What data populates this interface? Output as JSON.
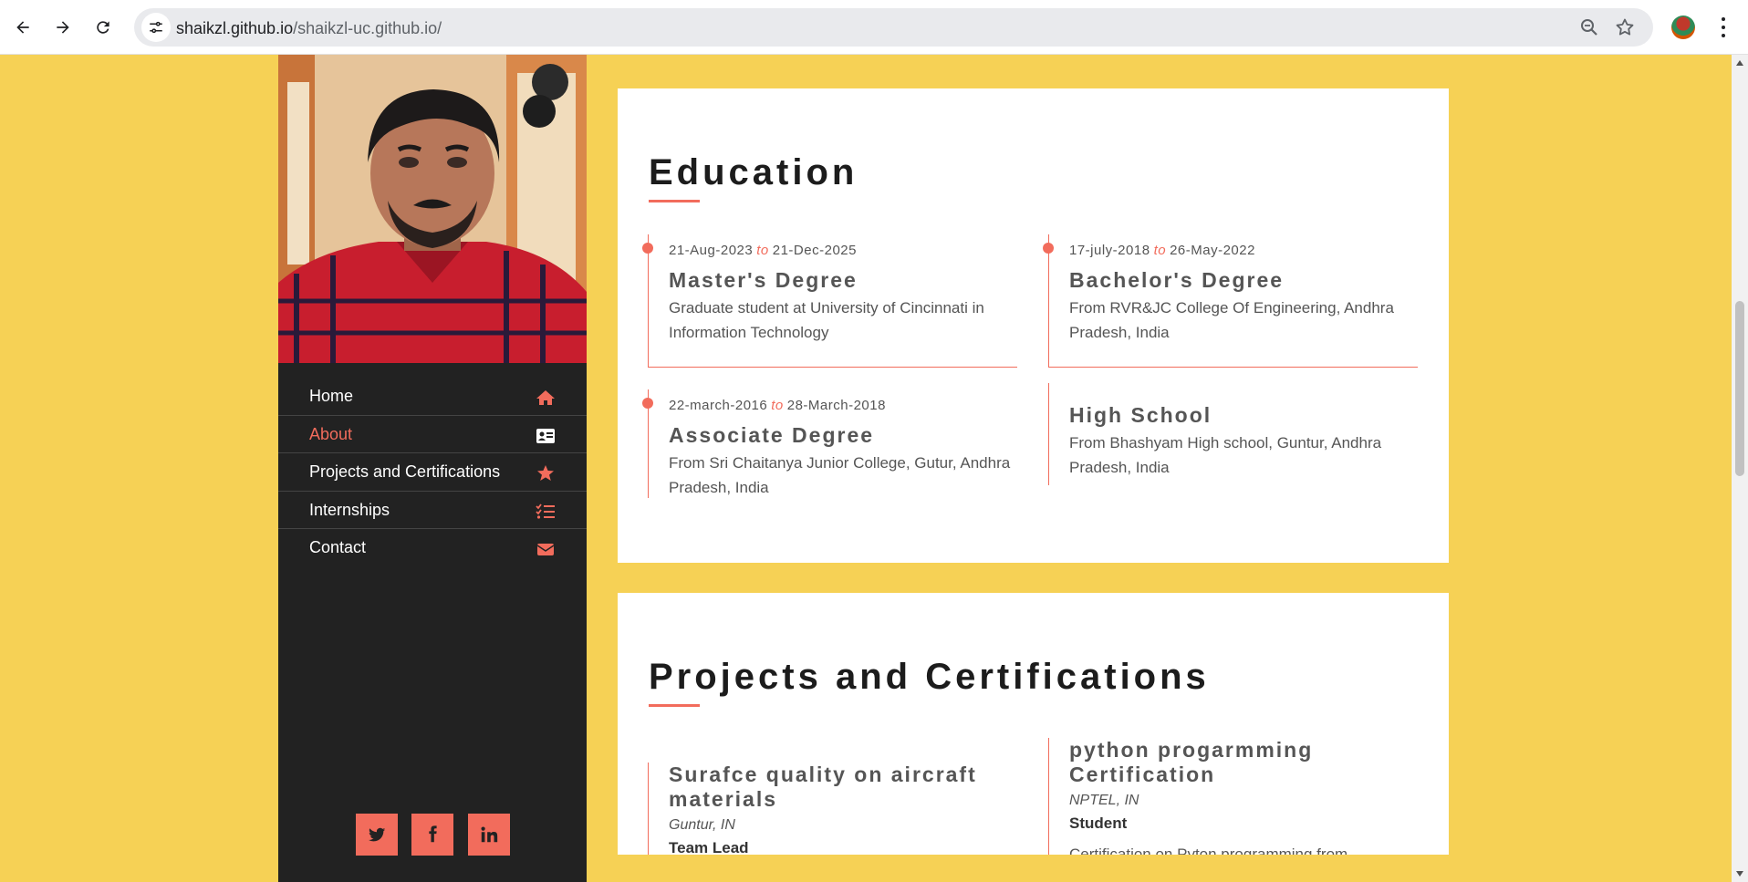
{
  "browser": {
    "url_host": "shaikzl.github.io",
    "url_path": "/shaikzl-uc.github.io/"
  },
  "colors": {
    "accent": "#f26c5c",
    "page_background": "#f6d155",
    "sidebar_background": "#222222"
  },
  "sidebar": {
    "photo_icon": "profile-photo",
    "nav": [
      {
        "label": "Home",
        "icon": "home-icon",
        "active": false
      },
      {
        "label": "About",
        "icon": "id-card-icon",
        "active": true
      },
      {
        "label": "Projects and Certifications",
        "icon": "star-icon",
        "active": false
      },
      {
        "label": "Internships",
        "icon": "list-check-icon",
        "active": false
      },
      {
        "label": "Contact",
        "icon": "envelope-icon",
        "active": false
      }
    ],
    "social": [
      {
        "icon": "twitter-icon"
      },
      {
        "icon": "facebook-icon"
      },
      {
        "icon": "linkedin-icon"
      }
    ]
  },
  "education": {
    "title": "Education",
    "items": [
      {
        "start": "21-Aug-2023",
        "to": "to",
        "end": "21-Dec-2025",
        "degree": "Master's Degree",
        "desc": "Graduate student at University of Cincinnati in Information Technology"
      },
      {
        "start": "17-july-2018",
        "to": "to",
        "end": "26-May-2022",
        "degree": "Bachelor's Degree",
        "desc": "From RVR&JC College Of Engineering, Andhra Pradesh, India"
      },
      {
        "start": "22-march-2016",
        "to": "to",
        "end": "28-March-2018",
        "degree": "Associate Degree",
        "desc": "From Sri Chaitanya Junior College, Gutur, Andhra Pradesh, India"
      },
      {
        "degree": "High School",
        "desc": "From Bhashyam High school, Guntur, Andhra Pradesh, India"
      }
    ]
  },
  "projects": {
    "title": "Projects and Certifications",
    "items": [
      {
        "title": "Surafce quality on aircraft materials",
        "location": "Guntur, IN",
        "role": "Team Lead"
      },
      {
        "title": "python progarmming Certification",
        "location": "NPTEL, IN",
        "role": "Student",
        "desc": "Certification on Pyton programming from"
      }
    ]
  }
}
